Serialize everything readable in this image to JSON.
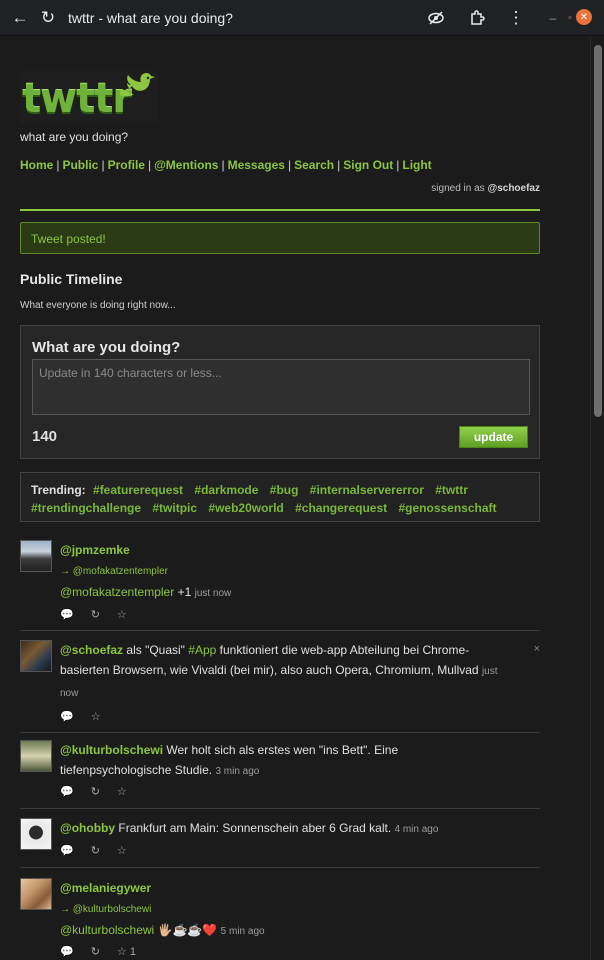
{
  "browser": {
    "title": "twttr - what are you doing?"
  },
  "site": {
    "logo_text": "twttr",
    "tagline": "what are you doing?",
    "nav": [
      "Home",
      "Public",
      "Profile",
      "@Mentions",
      "Messages",
      "Search",
      "Sign Out",
      "Light"
    ],
    "signed_in_prefix": "signed in as",
    "signed_in_user": "@schoefaz"
  },
  "flash": "Tweet posted!",
  "timeline": {
    "title": "Public Timeline",
    "subtitle": "What everyone is doing right now..."
  },
  "compose": {
    "question": "What are you doing?",
    "placeholder": "Update in 140 characters or less...",
    "counter": "140",
    "button": "update"
  },
  "trending": {
    "label": "Trending:",
    "tags": [
      "#featurerequest",
      "#darkmode",
      "#bug",
      "#internalservererror",
      "#twttr",
      "#trendingchallenge",
      "#twitpic",
      "#web20world",
      "#changerequest",
      "#genossenschaft"
    ]
  },
  "tweets": [
    {
      "user": "@jpmzemke",
      "reply_to": "→ @mofakatzentempler",
      "mention": "@mofakatzentempler",
      "text": " +1 ",
      "time": "just now",
      "actions": [
        "💬",
        "↻",
        "☆"
      ]
    },
    {
      "user": "@schoefaz",
      "text_a": " als \"Quasi\" ",
      "hashtag": "#App",
      "text_b": " funktioniert die web-app Abteilung bei Chrome-basierten Browsern, wie Vivaldi (bei mir), also auch Opera, Chromium, Mullvad ",
      "time": "just now",
      "delete": "×",
      "actions": [
        "💬",
        "☆"
      ]
    },
    {
      "user": "@kulturbolschewi",
      "text": " Wer holt sich als erstes wen \"ins Bett\". Eine tiefenpsychologische Studie. ",
      "time": "3 min ago",
      "actions": [
        "💬",
        "↻",
        "☆"
      ]
    },
    {
      "user": "@ohobby",
      "text": " Frankfurt am Main: Sonnenschein aber 6 Grad kalt. ",
      "time": "4 min ago",
      "actions": [
        "💬",
        "↻",
        "☆"
      ]
    },
    {
      "user": "@melaniegywer",
      "reply_to": "→ @kulturbolschewi",
      "mention": "@kulturbolschewi",
      "text": " 🖐🏼☕☕❤️ ",
      "time": "5 min ago",
      "actions": [
        "💬",
        "↻",
        "☆"
      ],
      "fav_count": "1"
    }
  ]
}
